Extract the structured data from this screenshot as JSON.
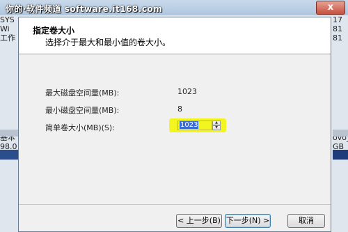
{
  "background": {
    "watermark": "你的·软件频道 software.it168.com",
    "left_text": [
      "SYS",
      "Wi",
      "工作",
      "",
      "",
      "",
      "",
      "",
      "",
      "",
      "",
      "",
      "",
      "基本",
      "98.0",
      "联机"
    ],
    "right_text": [
      "17",
      "81",
      "81",
      "",
      "",
      "",
      "",
      "",
      "",
      "",
      "",
      "",
      "",
      "ovo_",
      "GB",
      "状态"
    ],
    "close_glyph": "x"
  },
  "dialog": {
    "title": "指定卷大小",
    "subtitle": "选择介于最大和最小值的卷大小。",
    "max_label": "最大磁盘空间量(MB):",
    "max_value": "1023",
    "min_label": "最小磁盘空间量(MB):",
    "min_value": "8",
    "size_label": "简单卷大小(MB)(S):",
    "size_value": "1023",
    "spin_up": "▲",
    "spin_down": "▼",
    "highlight_color": "#f3f520"
  },
  "buttons": {
    "back": "< 上一步(B)",
    "next": "下一步(N) >",
    "cancel": "取消"
  }
}
